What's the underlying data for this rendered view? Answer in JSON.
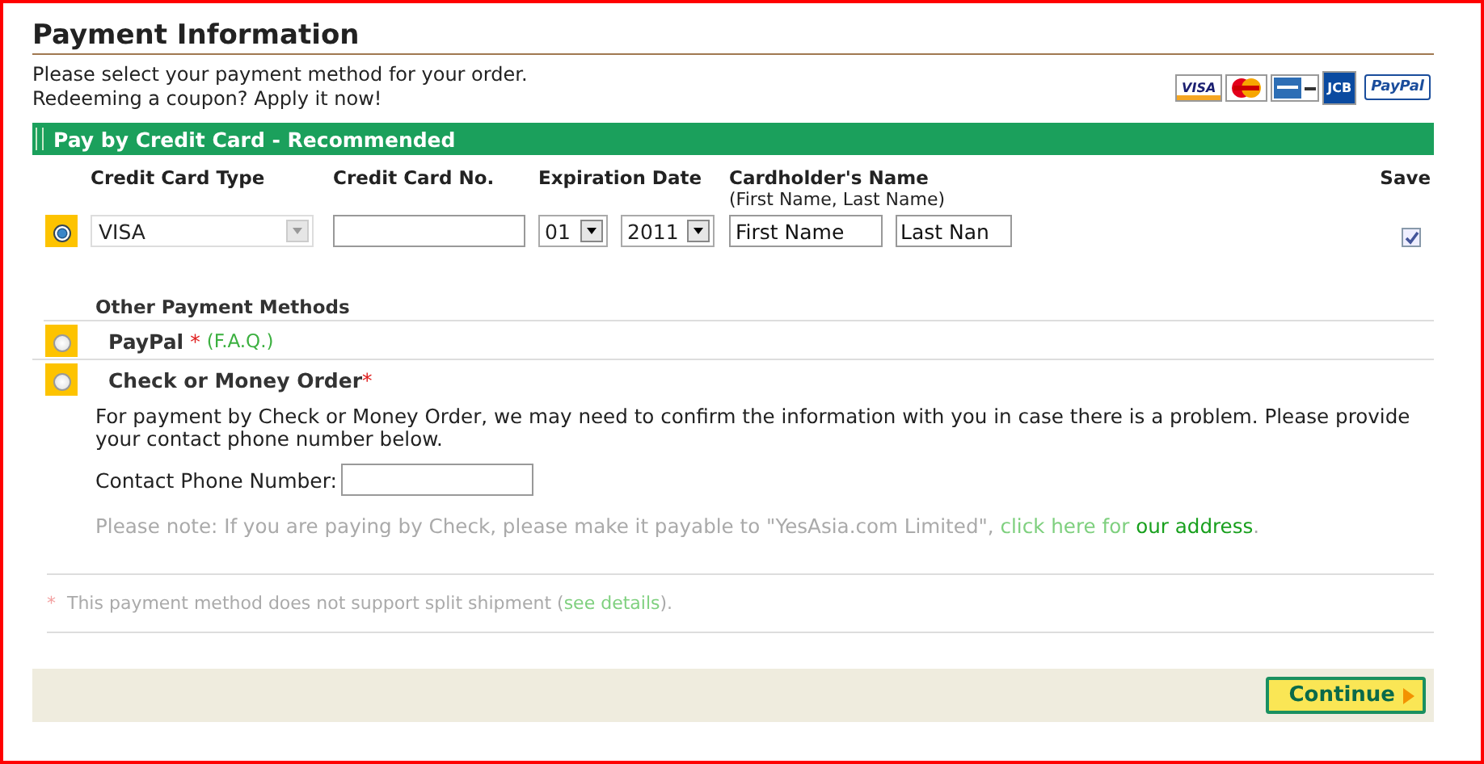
{
  "title": "Payment Information",
  "intro": [
    "Please select your payment method for your order.",
    "Redeeming a coupon? Apply it now!"
  ],
  "logos": [
    {
      "kind": "visa",
      "label": "VISA"
    },
    {
      "kind": "mastercard"
    },
    {
      "kind": "amex"
    },
    {
      "kind": "jcb",
      "label": "JCB"
    },
    {
      "kind": "paypal",
      "label": "PayPal"
    }
  ],
  "section_title": "Pay by Credit Card - Recommended",
  "columns": [
    {
      "label": "Credit Card Type"
    },
    {
      "label": "Credit Card No."
    },
    {
      "label": "Expiration Date"
    },
    {
      "label": "Cardholder's Name",
      "note": "(First Name, Last Name)"
    },
    {
      "label": "Save"
    }
  ],
  "card": {
    "selected": true,
    "type": "VISA",
    "month": "01",
    "year": "2011",
    "first_name": "First Name",
    "last_name": "Last Nan",
    "save": true
  },
  "other_title": "Other Payment Methods",
  "methods": [
    {
      "label": "PayPal",
      "mark": "*",
      "link": "(F.A.Q.)",
      "selected": false
    },
    {
      "label": "Check or Money Order",
      "mark": "*",
      "selected": false
    }
  ],
  "check_info": "For payment by Check or Money Order, we may need to confirm the information with you in case there is a problem. Please provide your contact phone number below.",
  "phone_label": "Contact Phone Number:",
  "note": {
    "text": "Please note: If you are paying by Check, please make it payable to \"YesAsia.com Limited\",",
    "link1": "click here for",
    "link2": "our address",
    "end": "."
  },
  "footnote": {
    "mark": "*",
    "text": "This payment method does not support split shipment (",
    "link": "see details",
    "end": ")."
  },
  "continue": "Continue"
}
